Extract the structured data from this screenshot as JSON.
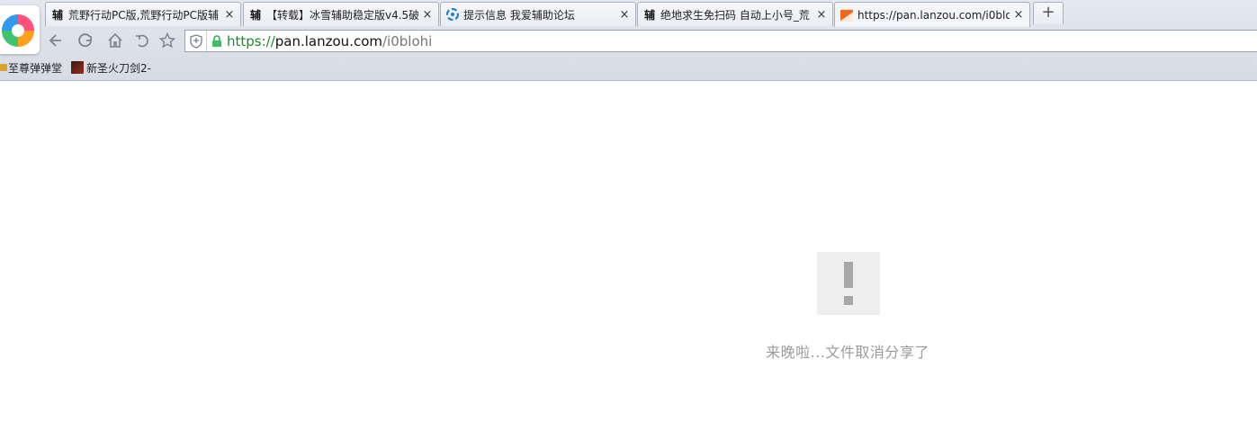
{
  "browser": {
    "tabs": [
      {
        "favicon": "辅",
        "title": "荒野行动PC版,荒野行动PC版辅",
        "close": "×",
        "active": false
      },
      {
        "favicon": "辅",
        "title": "【转载】冰雪辅助稳定版v4.5破",
        "close": "×",
        "active": false
      },
      {
        "favicon": "forum-logo-icon",
        "title": "提示信息 我爱辅助论坛",
        "close": "×",
        "active": false
      },
      {
        "favicon": "辅",
        "title": "绝地求生免扫码 自动上小号_荒",
        "close": "×",
        "active": false
      },
      {
        "favicon": "lanzou-logo-icon",
        "title": "https://pan.lanzou.com/i0blo",
        "close": "×",
        "active": true
      }
    ],
    "new_tab_label": "+",
    "address": {
      "scheme": "https://",
      "host": "pan.lanzou.com",
      "path": "/i0blohi"
    },
    "bookmarks": [
      {
        "icon": "folder-icon",
        "label": "至尊弹弹堂"
      },
      {
        "icon": "game-icon",
        "label": "新圣火刀剑2-"
      }
    ]
  },
  "page": {
    "notice_icon": "exclamation-icon",
    "notice_text": "来晚啦...文件取消分享了"
  }
}
